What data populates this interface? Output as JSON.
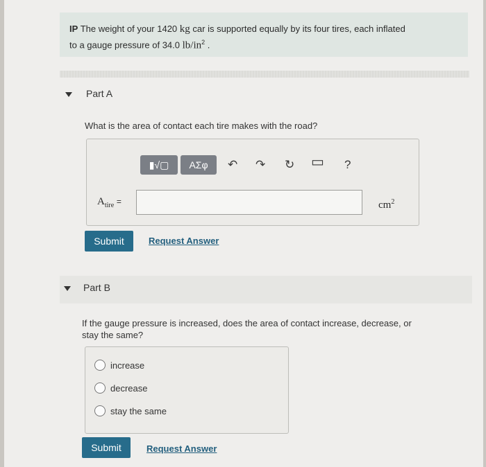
{
  "problem": {
    "prefix": "IP",
    "line1_a": "The weight of your 1420",
    "line1_unit": "kg",
    "line1_b": "car is supported equally by its four tires, each inflated",
    "line2_a": "to a gauge pressure of 34.0",
    "line2_unit": "lb/in",
    "line2_exp": "2",
    "line2_end": "."
  },
  "part_a": {
    "title": "Part A",
    "question": "What is the area of contact each tire makes with the road?",
    "toolbar": {
      "templates_label": "▮√▢",
      "symbols_label": "ΑΣφ",
      "undo_icon": "↶",
      "redo_icon": "↷",
      "reset_icon": "↻",
      "keyboard_icon": "▭",
      "help_label": "?"
    },
    "variable": "A",
    "variable_sub": "tire",
    "equals": "=",
    "input_value": "",
    "unit": "cm",
    "unit_exp": "2",
    "submit_label": "Submit",
    "request_label": "Request Answer"
  },
  "part_b": {
    "title": "Part B",
    "question_line1": "If the gauge pressure is increased, does the area of contact increase, decrease, or",
    "question_line2": "stay the same?",
    "options": [
      "increase",
      "decrease",
      "stay the same"
    ],
    "submit_label": "Submit",
    "request_label": "Request Answer"
  },
  "colors": {
    "accent": "#276c8b",
    "link": "#235f7e",
    "problem_bg": "#dfe6e2",
    "toolbar_button": "#7b7f86"
  }
}
